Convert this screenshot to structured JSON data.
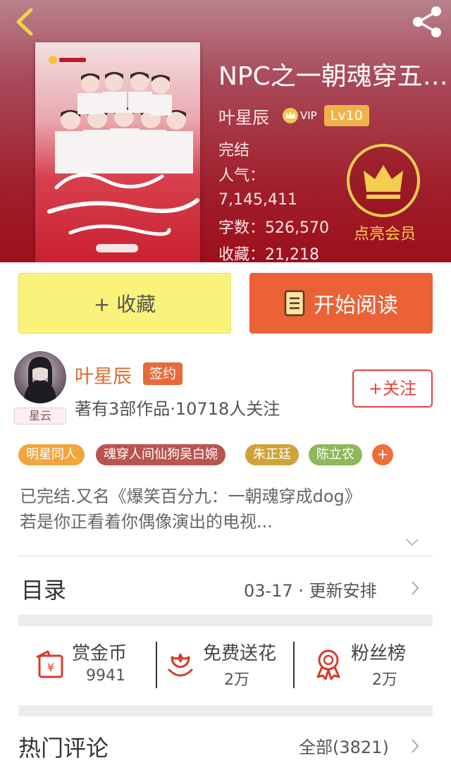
{
  "book": {
    "title": "NPC之一朝魂穿五…",
    "author": "叶星辰",
    "vip": "VIP",
    "level": "Lv10",
    "status": "完结",
    "popularity_label": "人气：",
    "popularity_value": "7,145,411",
    "word_count": "字数：526,570",
    "favorites": "收藏：21,218"
  },
  "vip_promo": {
    "label": "点亮会员"
  },
  "actions": {
    "collect": "+ 收藏",
    "read": "开始阅读"
  },
  "author": {
    "name": "叶星辰",
    "badge": "签约",
    "meta": "著有3部作品·10718人关注",
    "follow": "+关注",
    "avatar_tag": "星云"
  },
  "tags": [
    {
      "label": "明星同人",
      "color": "#f0a63c"
    },
    {
      "label": "魂穿人间仙狗吴白婉",
      "color": "#b9544e"
    },
    {
      "label": "朱正廷",
      "color": "#cfa33a"
    },
    {
      "label": "陈立农",
      "color": "#8fb85a"
    }
  ],
  "tags_more": "+",
  "description": {
    "line1": "已完结.又名《爆笑百分九：一朝魂穿成dog》",
    "line2": "若是你正看着你偶像演出的电视..."
  },
  "toc": {
    "title": "目录",
    "update": "03-17 · 更新安排"
  },
  "features": [
    {
      "label": "赏金币",
      "value": "9941",
      "icon": "reward-coin-icon"
    },
    {
      "label": "免费送花",
      "value": "2万",
      "icon": "flower-icon"
    },
    {
      "label": "粉丝榜",
      "value": "2万",
      "icon": "medal-icon"
    }
  ],
  "comments": {
    "title": "热门评论",
    "all": "全部(3821)"
  },
  "colors": {
    "accent": "#ea6235",
    "vip_gold": "#f2cf4e",
    "header_red": "#a0202c"
  }
}
